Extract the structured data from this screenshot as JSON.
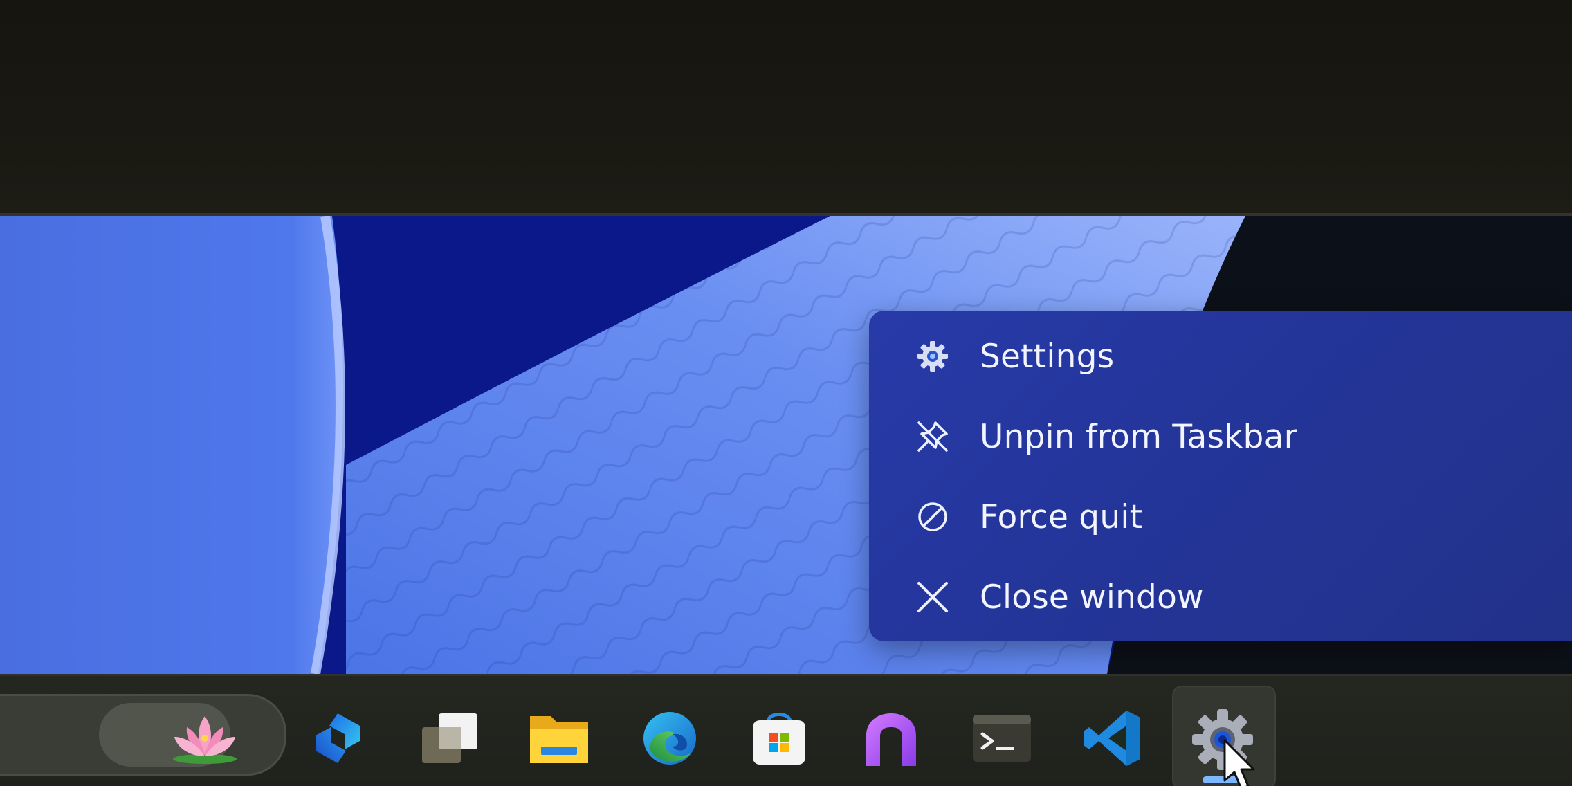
{
  "context_menu": {
    "items": [
      {
        "label": "Settings",
        "icon": "gear-icon"
      },
      {
        "label": "Unpin from Taskbar",
        "icon": "unpin-icon"
      },
      {
        "label": "Force quit",
        "icon": "prohibited-icon"
      },
      {
        "label": "Close window",
        "icon": "close-icon"
      }
    ]
  },
  "taskbar": {
    "search_icon": "lotus-icon",
    "apps": [
      {
        "name": "Copilot",
        "icon": "copilot-icon"
      },
      {
        "name": "Task View",
        "icon": "task-view-icon"
      },
      {
        "name": "File Explorer",
        "icon": "folder-icon"
      },
      {
        "name": "Microsoft Edge",
        "icon": "edge-icon"
      },
      {
        "name": "Microsoft Store",
        "icon": "store-icon"
      },
      {
        "name": "Arc",
        "icon": "arc-icon"
      },
      {
        "name": "Terminal",
        "icon": "terminal-icon"
      },
      {
        "name": "Visual Studio Code",
        "icon": "vscode-icon"
      },
      {
        "name": "Settings",
        "icon": "settings-gear-icon",
        "active": true
      }
    ]
  },
  "colors": {
    "menu_bg": "#243597",
    "wallpaper_dark": "#0d1a88",
    "wallpaper_light": "#5a7fe8",
    "taskbar_bg": "#222520",
    "active_indicator": "#7db7ff"
  }
}
